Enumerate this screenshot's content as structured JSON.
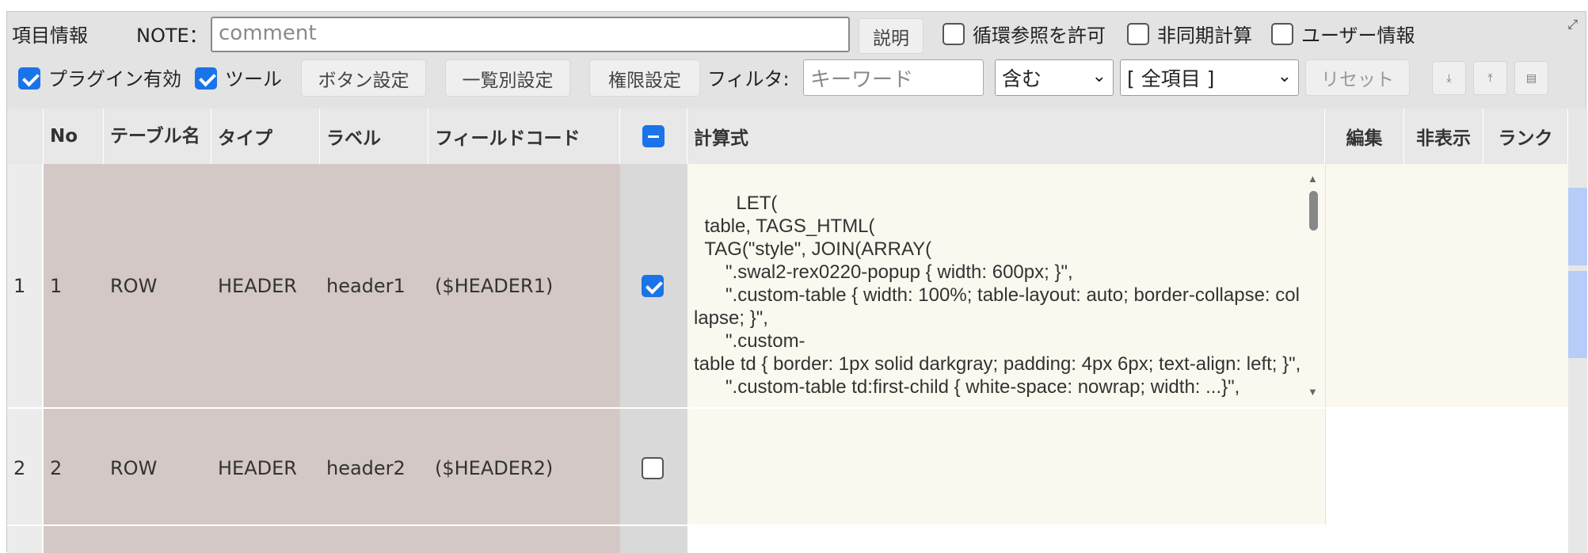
{
  "toolbar": {
    "section_label": "項目情報",
    "note_label": "NOTE：",
    "note_placeholder": "comment",
    "explain_button": "説明",
    "circular_ref_label": "循環参照を許可",
    "async_calc_label": "非同期計算",
    "user_info_label": "ユーザー情報",
    "plugin_enabled_label": "プラグイン有効",
    "tool_label": "ツール",
    "button_settings": "ボタン設定",
    "list_settings": "一覧別設定",
    "permission_settings": "権限設定",
    "filter_label": "フィルタ:",
    "keyword_placeholder": "キーワード",
    "match_select": "含む",
    "field_select": "[ 全項目 ]",
    "reset_button": "リセット",
    "icons": [
      "download-icon",
      "upload-icon",
      "clipboard-icon",
      "expand-icon"
    ]
  },
  "table": {
    "columns": [
      "No",
      "テーブル名",
      "タイプ",
      "ラベル",
      "フィールドコード",
      "計算式",
      "編集",
      "非表示",
      "ランク"
    ],
    "rows": [
      {
        "index": "1",
        "no": "1",
        "table": "ROW",
        "type": "HEADER",
        "label": "header1",
        "code": "($HEADER1)",
        "checked": true,
        "formula": "LET(\n  table, TAGS_HTML(\n  TAG(\"style\", JOIN(ARRAY(\n      \".swal2-rex0220-popup { width: 600px; }\",\n      \".custom-table { width: 100%; table-layout: auto; border-collapse: collapse; }\",\n      \".custom-\ntable td { border: 1px solid darkgray; padding: 4px 6px; text-align: left; }\",\n      \".custom-table td:first-child { white-space: nowrap; width: ...}\","
      },
      {
        "index": "2",
        "no": "2",
        "table": "ROW",
        "type": "HEADER",
        "label": "header2",
        "code": "($HEADER2)",
        "checked": false,
        "formula": ""
      }
    ]
  },
  "colors": {
    "accent": "#1a73e8",
    "dark_band": "#d3c8c6",
    "formula_bg": "#fbf9ef"
  }
}
